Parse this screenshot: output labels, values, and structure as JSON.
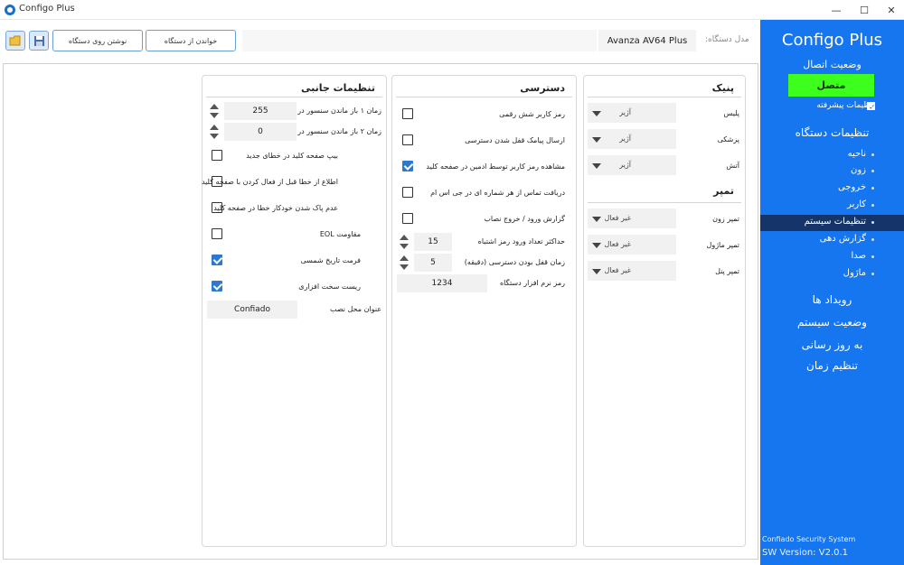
{
  "window": {
    "title": "Configo Plus",
    "minimize": "—",
    "maximize": "☐",
    "close": "✕"
  },
  "toolbar": {
    "write_to_device": "نوشتن روی دستگاه",
    "read_from_device": "خواندن از دستگاه",
    "device_name": "Avanza AV64 Plus",
    "device_label": "مدل دستگاه:"
  },
  "panic": {
    "title": "پنیک",
    "rows": [
      {
        "label": "پلیس",
        "value": "آژیر"
      },
      {
        "label": "پزشکی",
        "value": "آژیر"
      },
      {
        "label": "آتش",
        "value": "آژیر"
      }
    ],
    "tamper_title": "تمپر",
    "tamper_rows": [
      {
        "label": "تمپر زون",
        "value": "غیر فعال"
      },
      {
        "label": "تمپر ماژول",
        "value": "غیر فعال"
      },
      {
        "label": "تمپر پنل",
        "value": "غیر فعال"
      }
    ]
  },
  "access": {
    "title": "دسترسی",
    "checks": [
      {
        "label": "رمز کاربر شش رقمی",
        "checked": false
      },
      {
        "label": "ارسال پیامک قفل شدن دسترسی",
        "checked": false
      },
      {
        "label": "مشاهده رمز کاربر توسط ادمین در صفحه کلید",
        "checked": true
      },
      {
        "label": "دریافت تماس از هر شماره ای در جی اس ام",
        "checked": false
      },
      {
        "label": "گزارش ورود / خروج نصاب",
        "checked": false
      }
    ],
    "max_wrong_label": "حداکثر تعداد ورود رمز اشتباه",
    "max_wrong_value": "15",
    "lock_time_label": "زمان قفل بودن دسترسی (دقیقه)",
    "lock_time_value": "5",
    "software_pass_label": "رمز نرم افزار دستگاه",
    "software_pass_value": "1234"
  },
  "side": {
    "title": "تنظیمات جانبی",
    "sensor1_label": "زمان ۱ باز ماندن سنسور در",
    "sensor1_value": "255",
    "sensor2_label": "زمان ۲ باز ماندن سنسور در",
    "sensor2_value": "0",
    "checks": [
      {
        "label": "بیپ صفحه کلید در خطای جدید",
        "checked": false
      },
      {
        "label": "اطلاع از خطا قبل از فعال کردن با صفحه کلید",
        "checked": false
      },
      {
        "label": "عدم پاک شدن خودکار خطا در صفحه کلید",
        "checked": false
      },
      {
        "label": "مقاومت EOL",
        "checked": false
      },
      {
        "label": "فرمت تاریخ شمسی",
        "checked": true
      },
      {
        "label": "ریست سخت افزاری",
        "checked": true
      }
    ],
    "install_title_label": "عنوان محل نصب",
    "install_title_value": "Confiado"
  },
  "sidebar": {
    "brand": "Configo Plus",
    "connection_status_title": "وضعیت اتصال",
    "connected": "متصل",
    "advanced_settings": "تنظیمات پیشرفته",
    "device_settings": "تنظیمات دستگاه",
    "sub_items": [
      "ناحیه",
      "زون",
      "خروجی",
      "کاربر",
      "تنظیمات سیستم",
      "گزارش دهی",
      "صدا",
      "ماژول"
    ],
    "events": "رویداد ها",
    "system_status": "وضعیت سیستم",
    "update": "به روز رسانی",
    "set_time": "تنظیم زمان",
    "footer_company": "Confiado Security System",
    "footer_version": "SW Version: V2.0.1"
  },
  "colors": {
    "accent": "#1676f0",
    "connected": "#3cff1e",
    "active_item": "#15356a",
    "checkbox_on": "#2b79d1"
  }
}
